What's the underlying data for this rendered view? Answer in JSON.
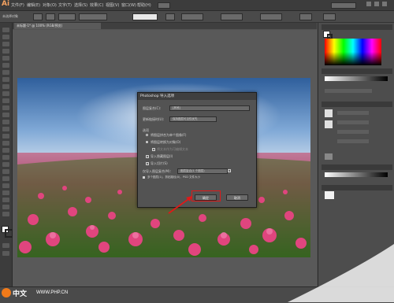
{
  "app": {
    "logo": "Ai"
  },
  "menubar": {
    "items": [
      "文件(F)",
      "编辑(E)",
      "对象(O)",
      "文字(T)",
      "选择(S)",
      "效果(C)",
      "视图(V)",
      "窗口(W)",
      "帮助(H)"
    ]
  },
  "ctrlbar": {
    "label": "未选择对象"
  },
  "document": {
    "tab_label": "未标题-1* @ 100% (RGB/预览)"
  },
  "dialog": {
    "title": "Photoshop 导入选项",
    "comp_label": "图层复合(C):",
    "comp_value": "[其他]",
    "update_label": "更新链接时(U):",
    "update_value": "保持图层可见性优先",
    "options_label": "选项",
    "opt_flatten": "将图层拼合为单个图像(F)",
    "opt_convert": "将图层转换为对象(O)",
    "opt_text": "将文本作为可编辑文本",
    "opt_import_hidden": "导入隐藏图层(I)",
    "opt_slices": "导入切片(S)",
    "extra_label": "仅导入图层复合(M)：",
    "extra_value": "图层复合(1 个图层)",
    "info_label": "多个图层(1)，剪贴路径(0)，PSD 文件大小",
    "ok_label": "确定",
    "cancel_label": "取消"
  },
  "colors": {
    "highlight": "#e01818",
    "accent": "#f07a1a"
  },
  "watermark": {
    "text": "中文",
    "sub": "WWW.PHP.CN"
  }
}
